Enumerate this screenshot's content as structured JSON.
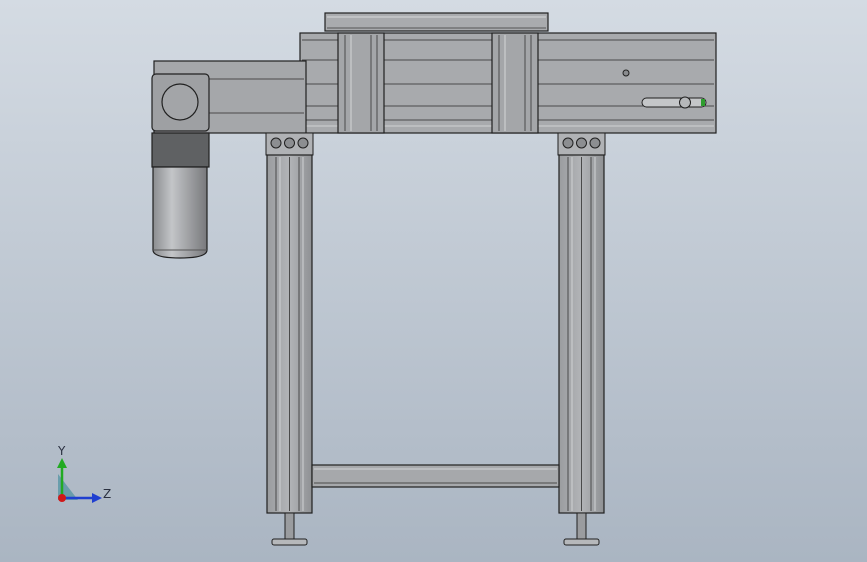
{
  "scene": {
    "background_top": "#d4dbe3",
    "background_bottom": "#aab5c2",
    "part_color": "#a7a9ac",
    "outline_color": "#202020"
  },
  "triad": {
    "y_label": "Y",
    "z_label": "Z",
    "y_color": "#22aa22",
    "z_color": "#1f3fd0",
    "x_color": "#d01818"
  },
  "slot_indicator": {
    "end_color": "#2e9e2e"
  }
}
